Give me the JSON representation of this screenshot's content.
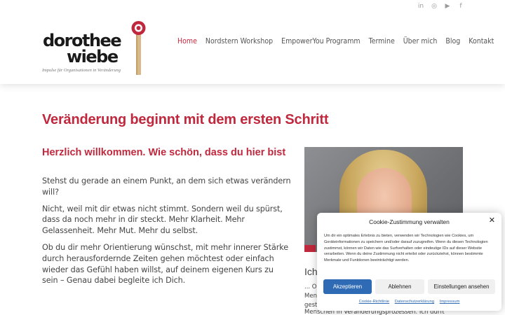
{
  "header": {
    "social": [
      {
        "icon": "linkedin-icon",
        "glyph": "in"
      },
      {
        "icon": "instagram-icon",
        "glyph": "◎"
      },
      {
        "icon": "youtube-icon",
        "glyph": "▶"
      },
      {
        "icon": "facebook-icon",
        "glyph": "f"
      }
    ],
    "logo": {
      "line1": "dorothee",
      "line2": "wiebe",
      "tagline": "Impulse für Organisationen in Veränderung"
    },
    "nav": [
      {
        "label": "Home",
        "active": true
      },
      {
        "label": "Nordstern Workshop",
        "active": false
      },
      {
        "label": "EmpowerYou Programm",
        "active": false
      },
      {
        "label": "Termine",
        "active": false
      },
      {
        "label": "Über mich",
        "active": false
      },
      {
        "label": "Blog",
        "active": false
      },
      {
        "label": "Kontakt",
        "active": false
      }
    ]
  },
  "main": {
    "heading": "Veränderung beginnt mit dem ersten Schritt",
    "subheading": "Herzlich willkommen. Wie schön, dass du hier bist",
    "paragraphs": [
      "Stehst du gerade an einem Punkt, an dem sich etwas verändern will?",
      "Nicht, weil mit dir etwas nicht stimmt. Sondern weil du spürst, dass da noch mehr in dir steckt. Mehr Klarheit. Mehr Gelassenheit. Mehr Mut. Mehr du selbst.",
      "Ob du dir mehr Orientierung wünschst, mit mehr innerer Stärke durch herausfordernde Zeiten gehen möchtest oder einfach wieder das Gefühl haben willst, auf deinem eigenen Kurs zu sein – Genau dabei begleite ich Dich."
    ],
    "side_heading": "Ich",
    "side_lines": [
      "... O",
      "Men",
      "gest"
    ],
    "side_bottom": "Menschen in Veränderungsprozessen. Ich durfte"
  },
  "cookie": {
    "title": "Cookie-Zustimmung verwalten",
    "text": "Um dir ein optimales Erlebnis zu bieten, verwenden wir Technologien wie Cookies, um Geräteinformationen zu speichern und/oder darauf zuzugreifen. Wenn du diesen Technologien zustimmst, können wir Daten wie das Surfverhalten oder eindeutige IDs auf dieser Website verarbeiten. Wenn du deine Zustimmung nicht erteilst oder zurückziehst, können bestimmte Merkmale und Funktionen beeinträchtigt werden.",
    "accept": "Akzeptieren",
    "deny": "Ablehnen",
    "settings": "Einstellungen ansehen",
    "links": [
      "Cookie-Richtlinie",
      "Datenschutzerklärung",
      "Impressum"
    ]
  },
  "colors": {
    "accent": "#c0283d",
    "button_primary": "#2f6bb5"
  }
}
